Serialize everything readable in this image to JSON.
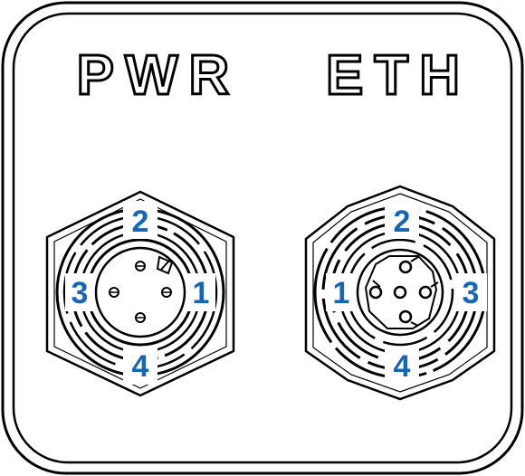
{
  "panel": {
    "pwr_label": "PWR",
    "eth_label": "ETH",
    "pin_color": "#1566B4",
    "line_color": "#000000"
  },
  "pwr_connector": {
    "pins": {
      "top": "2",
      "right": "1",
      "bottom": "4",
      "left": "3"
    }
  },
  "eth_connector": {
    "pins": {
      "top": "2",
      "right": "3",
      "bottom": "4",
      "left": "1"
    }
  }
}
